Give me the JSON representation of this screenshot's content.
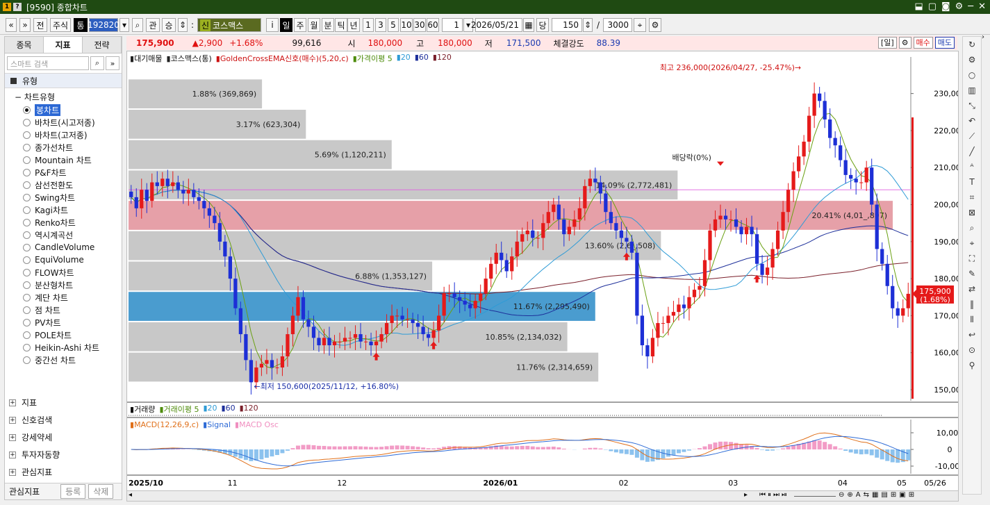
{
  "window": {
    "title": "[9590] 종합차트",
    "badge1": "1",
    "badge2": "?",
    "controls": [
      "⬓",
      "▢",
      "◙",
      "⚙",
      "─",
      "✕"
    ]
  },
  "toolbar": {
    "nav_prev": "«",
    "nav_down": "»",
    "btn_jeon": "전",
    "btn_stock": "주식",
    "btn_tong": "통",
    "code": "192820",
    "btn_gwan": "관",
    "btn_seung": "승",
    "market_tag": "신",
    "market_name": "코스맥스",
    "btn_info": "i",
    "periods": [
      "일",
      "주",
      "월",
      "분",
      "틱",
      "년"
    ],
    "intervals": [
      "1",
      "3",
      "5",
      "10",
      "30",
      "60"
    ],
    "count1": "1",
    "date": "2026/05/21",
    "btn_dang": "당",
    "count2": "150",
    "count3": "3000"
  },
  "left": {
    "tabs": [
      "종목",
      "지표",
      "전략"
    ],
    "search_placeholder": "스마트 검색",
    "section": "유형",
    "group": "차트유형",
    "items": [
      "봉차트",
      "바차트(시고저종)",
      "바차트(고저종)",
      "종가선차트",
      "Mountain 차트",
      "P&F차트",
      "삼선전환도",
      "Swing차트",
      "Kagi차트",
      "Renko차트",
      "역시계곡선",
      "CandleVolume",
      "EquiVolume",
      "FLOW차트",
      "분산형차트",
      "계단 차트",
      "점 차트",
      "PV차트",
      "POLE차트",
      "Heikin-Ashi 차트",
      "중간선 차트"
    ],
    "bottom": [
      "지표",
      "신호검색",
      "강세약세",
      "투자자동향",
      "관심지표"
    ],
    "footer": "관심지표",
    "btn_add": "등록",
    "btn_del": "삭제"
  },
  "pricebar": {
    "price": "175,900",
    "change": "▲2,900",
    "pct": "+1.68%",
    "volume": "99,616",
    "open_label": "시",
    "open": "180,000",
    "high_label": "고",
    "high": "180,000",
    "low_label": "저",
    "low": "171,500",
    "strength_label": "체결강도",
    "strength": "88.39",
    "day_btn": "[일]",
    "sell_btn": "매수",
    "buy_btn": "매도"
  },
  "legend_main": [
    "대기매물",
    "코스맥스(통)",
    "GoldenCrossEMA신호(매수)(5,20,c)",
    "가격이평 5",
    "20",
    "60",
    "120"
  ],
  "legend_volume": [
    "거래량",
    "거래이평 5",
    "20",
    "60",
    "120"
  ],
  "legend_macd": [
    "MACD(12,26,9,c)",
    "Signal",
    "MACD Osc"
  ],
  "annotations": {
    "high": "최고 236,000(2026/04/27, -25.47%)→",
    "low": "←최저 150,600(2025/11/12, +16.80%)",
    "dividend": "배당락(0%)",
    "last_price": "175,900",
    "last_pct": "(1.68%)"
  },
  "colors": {
    "up": "#e51a1a",
    "down": "#1d2fd6",
    "ma5": "#6aa012",
    "ma20": "#2e9bd6",
    "ma60": "#1d2f9a",
    "ma120": "#7a1f2a"
  },
  "chart_data": {
    "type": "candlestick",
    "x_labels": [
      "2025/10",
      "11",
      "12",
      "2026/01",
      "02",
      "03",
      "04",
      "05",
      "05/26"
    ],
    "y_ticks": [
      "230,000",
      "220,000",
      "210,000",
      "200,000",
      "190,000",
      "180,000",
      "170,000",
      "160,000",
      "150,000"
    ],
    "ylim": [
      147000,
      238000
    ],
    "macd_ticks": [
      "10,000",
      "0",
      "-10,000"
    ],
    "volume_profile": [
      {
        "label": "1.88% (369,869)",
        "pct": 1.88
      },
      {
        "label": "3.17% (623,304)",
        "pct": 3.17
      },
      {
        "label": "5.69% (1,120,211)",
        "pct": 5.69
      },
      {
        "label": "14.09% (2,772,481)",
        "pct": 14.09
      },
      {
        "label": "20.41% (4,01_,897)",
        "pct": 20.41
      },
      {
        "label": "13.60% (2,6_,508)",
        "pct": 13.6
      },
      {
        "label": "6.88% (1,353,127)",
        "pct": 6.88
      },
      {
        "label": "11.67% (2,295,490)",
        "pct": 11.67
      },
      {
        "label": "10.85% (2,134,032)",
        "pct": 10.85
      },
      {
        "label": "11.76% (2,314,659)",
        "pct": 11.76
      }
    ],
    "closes": [
      202000,
      199000,
      204000,
      201000,
      206000,
      205000,
      207000,
      205000,
      206000,
      204000,
      203000,
      204000,
      202000,
      201000,
      199000,
      197000,
      195000,
      190000,
      186000,
      180000,
      172000,
      165000,
      158000,
      152000,
      156000,
      157000,
      158000,
      156000,
      156000,
      159000,
      165000,
      170000,
      175000,
      169000,
      167000,
      164000,
      162000,
      164000,
      162000,
      163000,
      163000,
      164000,
      164000,
      165000,
      163000,
      163000,
      162000,
      163000,
      165000,
      168000,
      170000,
      170000,
      169000,
      169000,
      168000,
      167000,
      165000,
      164000,
      166000,
      170000,
      176000,
      176000,
      175000,
      174000,
      173000,
      172000,
      174000,
      176000,
      180000,
      184000,
      187000,
      185000,
      182000,
      186000,
      190000,
      192000,
      193000,
      191000,
      191000,
      195000,
      198000,
      200000,
      196000,
      192000,
      194000,
      196000,
      199000,
      205000,
      207000,
      206000,
      203000,
      198000,
      195000,
      193000,
      191000,
      190000,
      187000,
      170000,
      162000,
      159000,
      164000,
      168000,
      168000,
      170000,
      171000,
      173000,
      172000,
      175000,
      177000,
      178000,
      185000,
      193000,
      196000,
      197000,
      196000,
      196000,
      194000,
      192000,
      194000,
      192000,
      184000,
      181000,
      183000,
      188000,
      193000,
      198000,
      204000,
      209000,
      213000,
      217000,
      224000,
      230000,
      228000,
      223000,
      218000,
      216000,
      212000,
      208000,
      207000,
      206000,
      206000,
      210000,
      200000,
      188000,
      184000,
      178000,
      172000,
      170000,
      172000,
      175900
    ]
  }
}
